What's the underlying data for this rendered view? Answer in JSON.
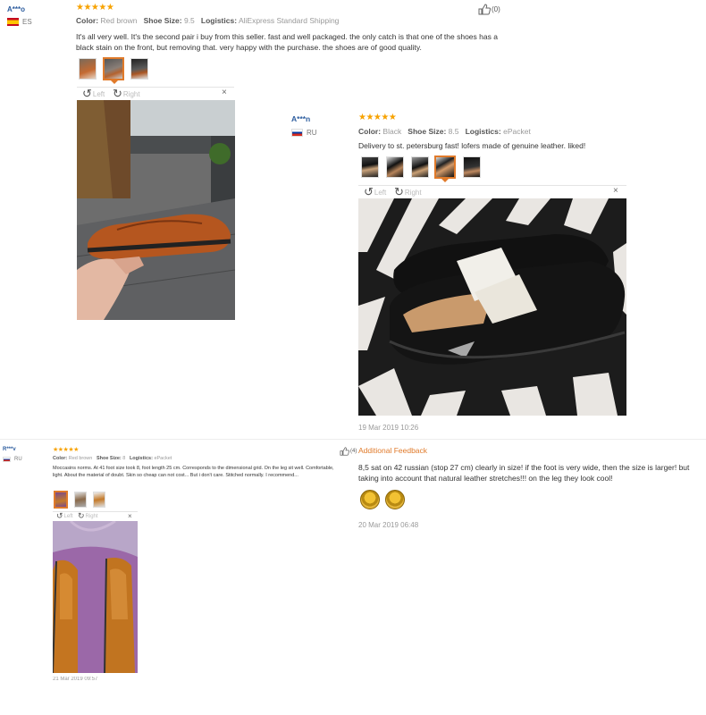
{
  "review1": {
    "user": "A***o",
    "country": "ES",
    "stars": "★★★★★",
    "color_label": "Color:",
    "color": "Red brown",
    "size_label": "Shoe Size:",
    "size": "9.5",
    "logistics_label": "Logistics:",
    "logistics": "AliExpress Standard Shipping",
    "like_count": "(0)",
    "text": "It's all very well. It's the second pair i buy from this seller. fast and well packaged. the only catch is that one of the shoes has a black stain on the front, but removing that. very happy with the purchase. the shoes are of good quality.",
    "viewer": {
      "left": "Left",
      "right": "Right",
      "close": "×"
    }
  },
  "review2": {
    "user": "A***n",
    "country": "RU",
    "stars": "★★★★★",
    "color_label": "Color:",
    "color": "Black",
    "size_label": "Shoe Size:",
    "size": "8.5",
    "logistics_label": "Logistics:",
    "logistics": "ePacket",
    "text": "Delivery to st. petersburg fast! lofers made of genuine leather. liked!",
    "viewer": {
      "left": "Left",
      "right": "Right",
      "close": "×"
    },
    "date": "19 Mar 2019 10:26"
  },
  "review3": {
    "user": "R***v",
    "country": "RU",
    "stars": "★★★★★",
    "color_label": "Color:",
    "color": "Red brown",
    "size_label": "Shoe Size:",
    "size": "8",
    "logistics_label": "Logistics:",
    "logistics": "ePacket",
    "text": "Moccasins norms. At 41 foot size took 8, foot length 25 cm. Corresponds to the dimensional grid. On the leg sit well. Comfortable, light. About the material of doubt. Skin so cheap can not cost... But i don't care. Stitched normally. I recommend...",
    "viewer": {
      "left": "Left",
      "right": "Right",
      "close": "×"
    },
    "date": "21 Mar 2019 09:57",
    "like_count": "(4)",
    "additional_feedback_label": "Additional Feedback",
    "additional_text": "8,5 sat on 42 russian (stop 27 cm) clearly in size! if the foot is very wide, then the size is larger! but taking into account that natural leather stretches!!! on the leg they look cool!",
    "additional_date": "20 Mar 2019 06:48"
  },
  "colors": {
    "username": "#2c5c9e",
    "stars": "#f7a200",
    "accent": "#e07a2a",
    "meta": "#999999"
  }
}
